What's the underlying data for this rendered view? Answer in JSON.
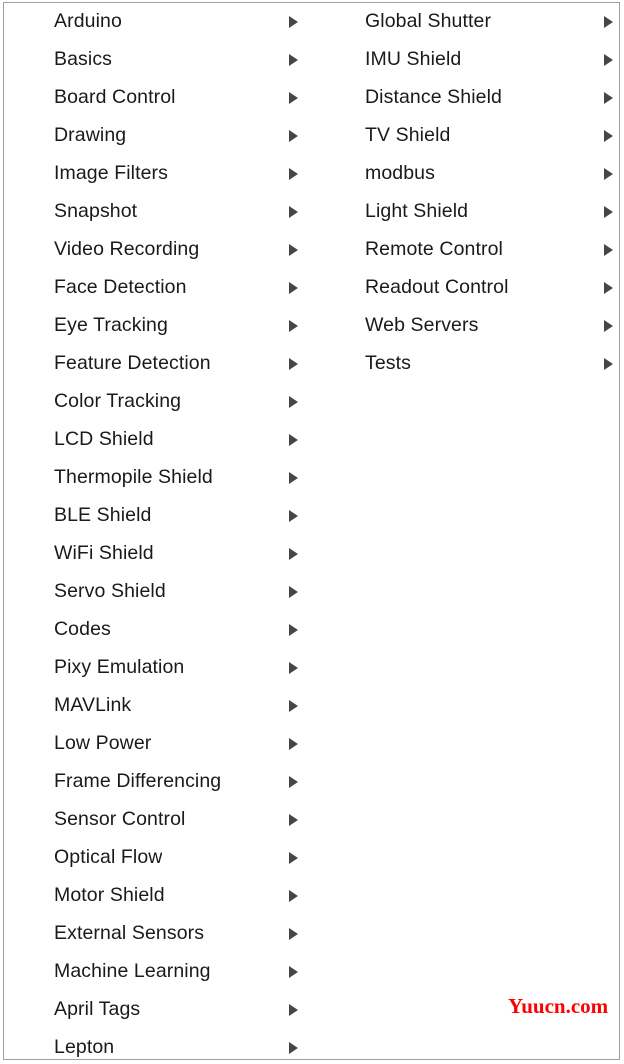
{
  "menu": {
    "columns": [
      {
        "name": "left-column",
        "items": [
          {
            "label": "Arduino",
            "has_submenu": true
          },
          {
            "label": "Basics",
            "has_submenu": true
          },
          {
            "label": "Board Control",
            "has_submenu": true
          },
          {
            "label": "Drawing",
            "has_submenu": true
          },
          {
            "label": "Image Filters",
            "has_submenu": true
          },
          {
            "label": "Snapshot",
            "has_submenu": true
          },
          {
            "label": "Video Recording",
            "has_submenu": true
          },
          {
            "label": "Face Detection",
            "has_submenu": true
          },
          {
            "label": "Eye Tracking",
            "has_submenu": true
          },
          {
            "label": "Feature Detection",
            "has_submenu": true
          },
          {
            "label": "Color Tracking",
            "has_submenu": true
          },
          {
            "label": "LCD Shield",
            "has_submenu": true
          },
          {
            "label": "Thermopile Shield",
            "has_submenu": true
          },
          {
            "label": "BLE Shield",
            "has_submenu": true
          },
          {
            "label": "WiFi Shield",
            "has_submenu": true
          },
          {
            "label": "Servo Shield",
            "has_submenu": true
          },
          {
            "label": "Codes",
            "has_submenu": true
          },
          {
            "label": "Pixy Emulation",
            "has_submenu": true
          },
          {
            "label": "MAVLink",
            "has_submenu": true
          },
          {
            "label": "Low Power",
            "has_submenu": true
          },
          {
            "label": "Frame Differencing",
            "has_submenu": true
          },
          {
            "label": "Sensor Control",
            "has_submenu": true
          },
          {
            "label": "Optical Flow",
            "has_submenu": true
          },
          {
            "label": "Motor Shield",
            "has_submenu": true
          },
          {
            "label": "External Sensors",
            "has_submenu": true
          },
          {
            "label": "Machine Learning",
            "has_submenu": true
          },
          {
            "label": "April Tags",
            "has_submenu": true
          },
          {
            "label": "Lepton",
            "has_submenu": true
          }
        ]
      },
      {
        "name": "right-column",
        "items": [
          {
            "label": "Global Shutter",
            "has_submenu": true
          },
          {
            "label": "IMU Shield",
            "has_submenu": true
          },
          {
            "label": "Distance Shield",
            "has_submenu": true
          },
          {
            "label": "TV Shield",
            "has_submenu": true
          },
          {
            "label": "modbus",
            "has_submenu": true
          },
          {
            "label": "Light Shield",
            "has_submenu": true
          },
          {
            "label": "Remote Control",
            "has_submenu": true
          },
          {
            "label": "Readout Control",
            "has_submenu": true
          },
          {
            "label": "Web Servers",
            "has_submenu": true
          },
          {
            "label": "Tests",
            "has_submenu": true
          }
        ]
      }
    ]
  },
  "watermark": {
    "text": "Yuucn.com",
    "color": "#ff0000"
  },
  "colors": {
    "background": "#ffffff",
    "border": "#9e9e9e",
    "text": "#1a1a1a",
    "arrow": "#464646"
  }
}
